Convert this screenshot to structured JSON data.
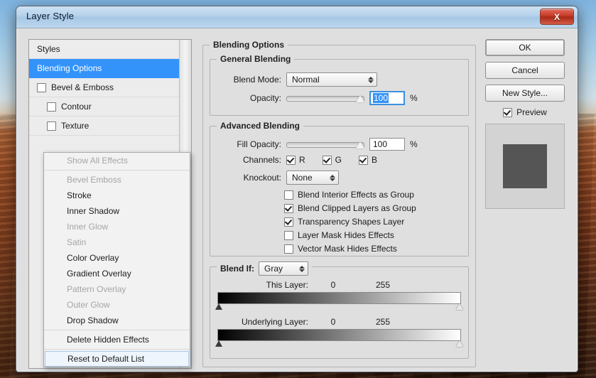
{
  "window": {
    "title": "Layer Style",
    "close_label": "X"
  },
  "styles_list": {
    "items": [
      {
        "label": "Styles",
        "checkbox": "none",
        "indent": false,
        "selected": false
      },
      {
        "label": "Blending Options",
        "checkbox": "none",
        "indent": false,
        "selected": true
      },
      {
        "label": "Bevel & Emboss",
        "checkbox": "unchecked",
        "indent": false,
        "selected": false
      },
      {
        "label": "Contour",
        "checkbox": "unchecked",
        "indent": true,
        "selected": false
      },
      {
        "label": "Texture",
        "checkbox": "unchecked",
        "indent": true,
        "selected": false
      }
    ],
    "trash_icon": "trash-icon"
  },
  "context_menu": {
    "items": [
      {
        "label": "Show All Effects",
        "state": "disabled",
        "separator_after": true
      },
      {
        "label": "Bevel  Emboss",
        "state": "disabled",
        "separator_after": false
      },
      {
        "label": "Stroke",
        "state": "enabled",
        "separator_after": false
      },
      {
        "label": "Inner Shadow",
        "state": "enabled",
        "separator_after": false
      },
      {
        "label": "Inner Glow",
        "state": "disabled",
        "separator_after": false
      },
      {
        "label": "Satin",
        "state": "disabled",
        "separator_after": false
      },
      {
        "label": "Color Overlay",
        "state": "enabled",
        "separator_after": false
      },
      {
        "label": "Gradient Overlay",
        "state": "enabled",
        "separator_after": false
      },
      {
        "label": "Pattern Overlay",
        "state": "disabled",
        "separator_after": false
      },
      {
        "label": "Outer Glow",
        "state": "disabled",
        "separator_after": false
      },
      {
        "label": "Drop Shadow",
        "state": "enabled",
        "separator_after": true
      },
      {
        "label": "Delete Hidden Effects",
        "state": "enabled",
        "separator_after": true
      },
      {
        "label": "Reset to Default List",
        "state": "highlight",
        "separator_after": false
      }
    ]
  },
  "blending_options": {
    "legend": "Blending Options",
    "general": {
      "legend": "General Blending",
      "blend_mode_label": "Blend Mode:",
      "blend_mode_value": "Normal",
      "opacity_label": "Opacity:",
      "opacity_value": "100",
      "opacity_unit": "%"
    },
    "advanced": {
      "legend": "Advanced Blending",
      "fill_opacity_label": "Fill Opacity:",
      "fill_opacity_value": "100",
      "fill_opacity_unit": "%",
      "channels_label": "Channels:",
      "channels": [
        {
          "label": "R",
          "checked": true
        },
        {
          "label": "G",
          "checked": true
        },
        {
          "label": "B",
          "checked": true
        }
      ],
      "knockout_label": "Knockout:",
      "knockout_value": "None",
      "checkboxes": [
        {
          "label": "Blend Interior Effects as Group",
          "checked": false
        },
        {
          "label": "Blend Clipped Layers as Group",
          "checked": true
        },
        {
          "label": "Transparency Shapes Layer",
          "checked": true
        },
        {
          "label": "Layer Mask Hides Effects",
          "checked": false
        },
        {
          "label": "Vector Mask Hides Effects",
          "checked": false
        }
      ]
    },
    "blend_if": {
      "legend": "Blend If:",
      "channel_value": "Gray",
      "sliders": [
        {
          "label": "This Layer:",
          "min": "0",
          "max": "255"
        },
        {
          "label": "Underlying Layer:",
          "min": "0",
          "max": "255"
        }
      ]
    }
  },
  "right_panel": {
    "ok_label": "OK",
    "cancel_label": "Cancel",
    "new_style_label": "New Style...",
    "preview_label": "Preview",
    "preview_checked": true,
    "swatch_color": "#555555"
  }
}
